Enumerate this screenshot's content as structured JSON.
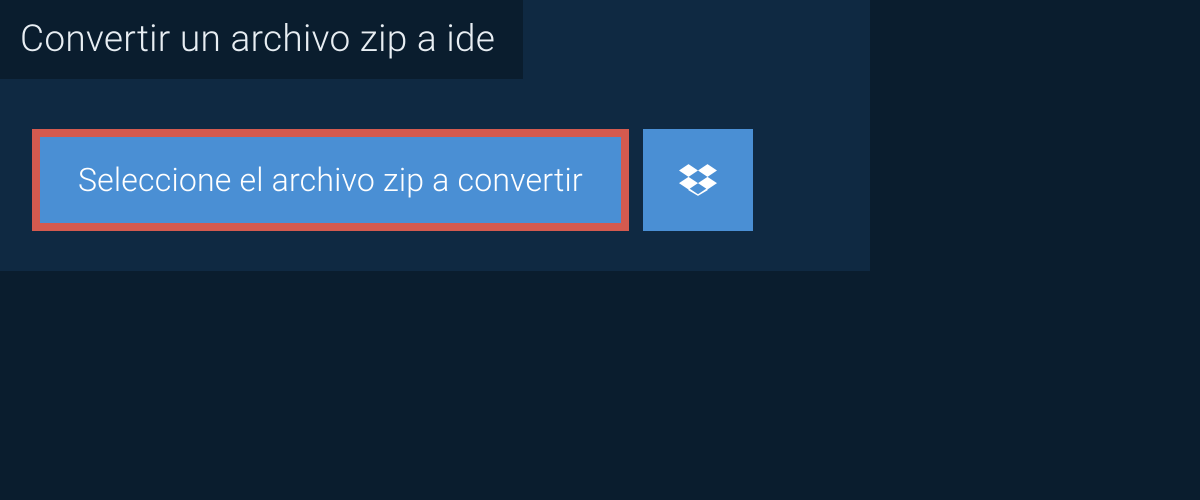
{
  "page": {
    "title": "Convertir un archivo zip a ide"
  },
  "actions": {
    "select_file_label": "Seleccione el archivo zip a convertir"
  },
  "colors": {
    "background": "#0a1d2e",
    "panel": "#0f2942",
    "button_primary": "#4a8fd4",
    "highlight_border": "#d45a4f",
    "text_light": "#e8eef3",
    "text_button": "#ffffff"
  }
}
